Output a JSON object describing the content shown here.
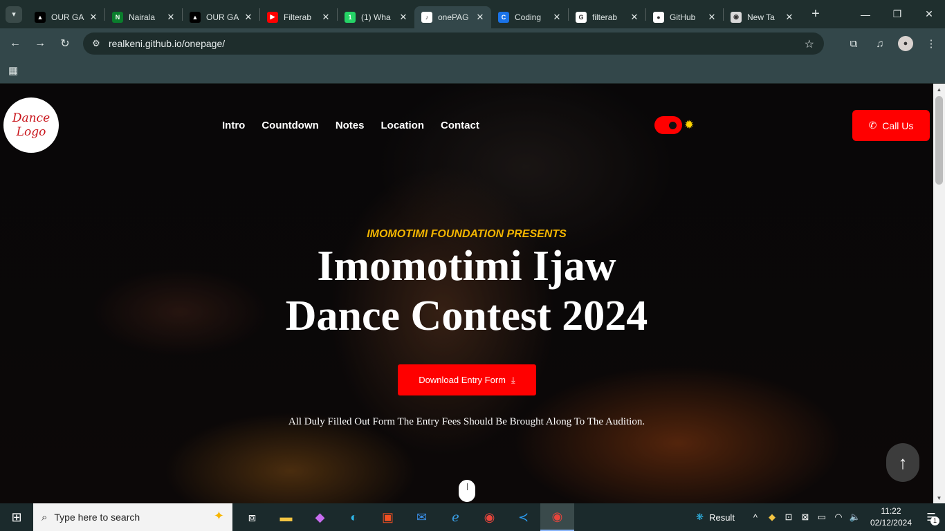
{
  "browser": {
    "tabs": [
      {
        "title": "OUR GA",
        "favicon": "vercel-icon",
        "color": "#000000",
        "glyph": "▲"
      },
      {
        "title": "Nairala",
        "favicon": "nairaland-icon",
        "color": "#0a7d2c",
        "glyph": "N"
      },
      {
        "title": "OUR GA",
        "favicon": "vercel-icon",
        "color": "#000000",
        "glyph": "▲"
      },
      {
        "title": "Filterab",
        "favicon": "youtube-icon",
        "color": "#ff0000",
        "glyph": "▶"
      },
      {
        "title": "(1) Wha",
        "favicon": "whatsapp-icon",
        "color": "#25d366",
        "glyph": "1"
      },
      {
        "title": "onePAG",
        "favicon": "dance-logo-icon",
        "color": "#ffffff",
        "glyph": "♪"
      },
      {
        "title": "Coding",
        "favicon": "codingnepal-icon",
        "color": "#1a73e8",
        "glyph": "C"
      },
      {
        "title": "filterab",
        "favicon": "google-icon",
        "color": "#ffffff",
        "glyph": "G"
      },
      {
        "title": "GitHub",
        "favicon": "github-icon",
        "color": "#ffffff",
        "glyph": "●"
      },
      {
        "title": "New Ta",
        "favicon": "chrome-icon",
        "color": "#d9d9d9",
        "glyph": "◉"
      }
    ],
    "active_tab": 5,
    "url": "realkeni.github.io/onepage/"
  },
  "page": {
    "logo_line1": "Dance",
    "logo_line2": "Logo",
    "nav": [
      "Intro",
      "Countdown",
      "Notes",
      "Location",
      "Contact"
    ],
    "call_label": "Call Us",
    "presents": "IMOMOTIMI FOUNDATION PRESENTS",
    "title_line1": "Imomotimi Ijaw",
    "title_line2": "Dance Contest 2024",
    "download_label": "Download Entry Form",
    "note": "All Duly Filled Out Form The Entry Fees Should Be Brought Along To The Audition.",
    "accent": "#ff0000",
    "gold": "#f3b500"
  },
  "taskbar": {
    "search_placeholder": "Type here to search",
    "weather_label": "Result",
    "time": "11:22",
    "date": "02/12/2024",
    "notification_count": "1"
  }
}
